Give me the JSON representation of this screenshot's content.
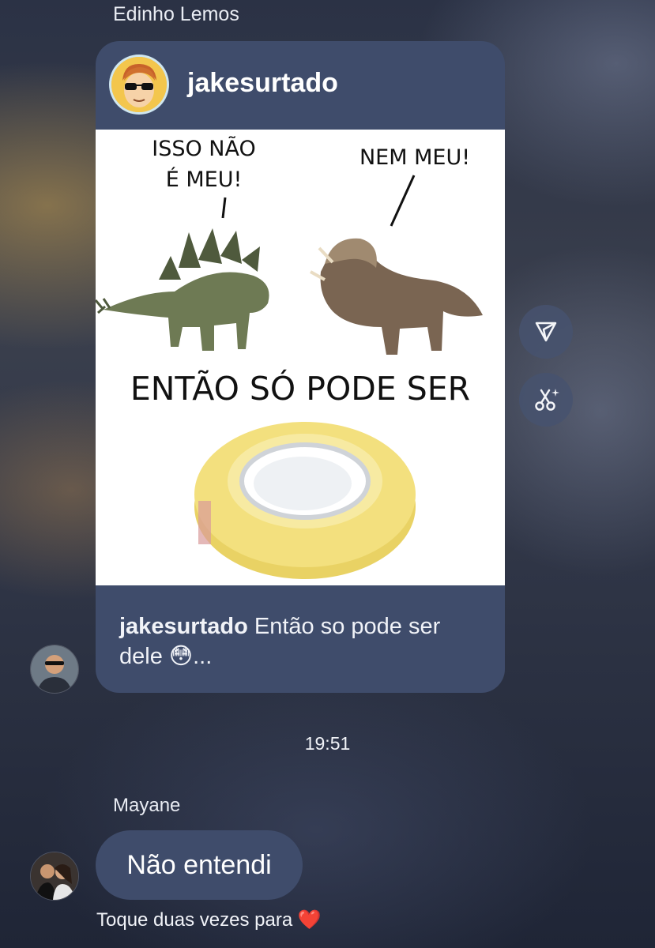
{
  "messages": [
    {
      "sender": "Edinho Lemos",
      "shared_post": {
        "username": "jakesurtado",
        "meme_texts": {
          "left_top": "ISSO NÃO",
          "left_bottom": "É MEU!",
          "right": "NEM MEU!",
          "middle": "ENTÃO SÓ PODE SER"
        },
        "caption_user": "jakesurtado",
        "caption_text": "Então so pode ser dele 😳..."
      }
    },
    {
      "sender": "Mayane",
      "text": "Não entendi",
      "reaction_hint": "Toque duas vezes para ❤️"
    }
  ],
  "timestamp": "19:51",
  "side_actions": [
    {
      "icon": "send-icon"
    },
    {
      "icon": "ai-scissors-icon"
    }
  ],
  "colors": {
    "bubble": "#3f4c6b",
    "text": "#ffffff",
    "tape": "#f0dc78"
  }
}
